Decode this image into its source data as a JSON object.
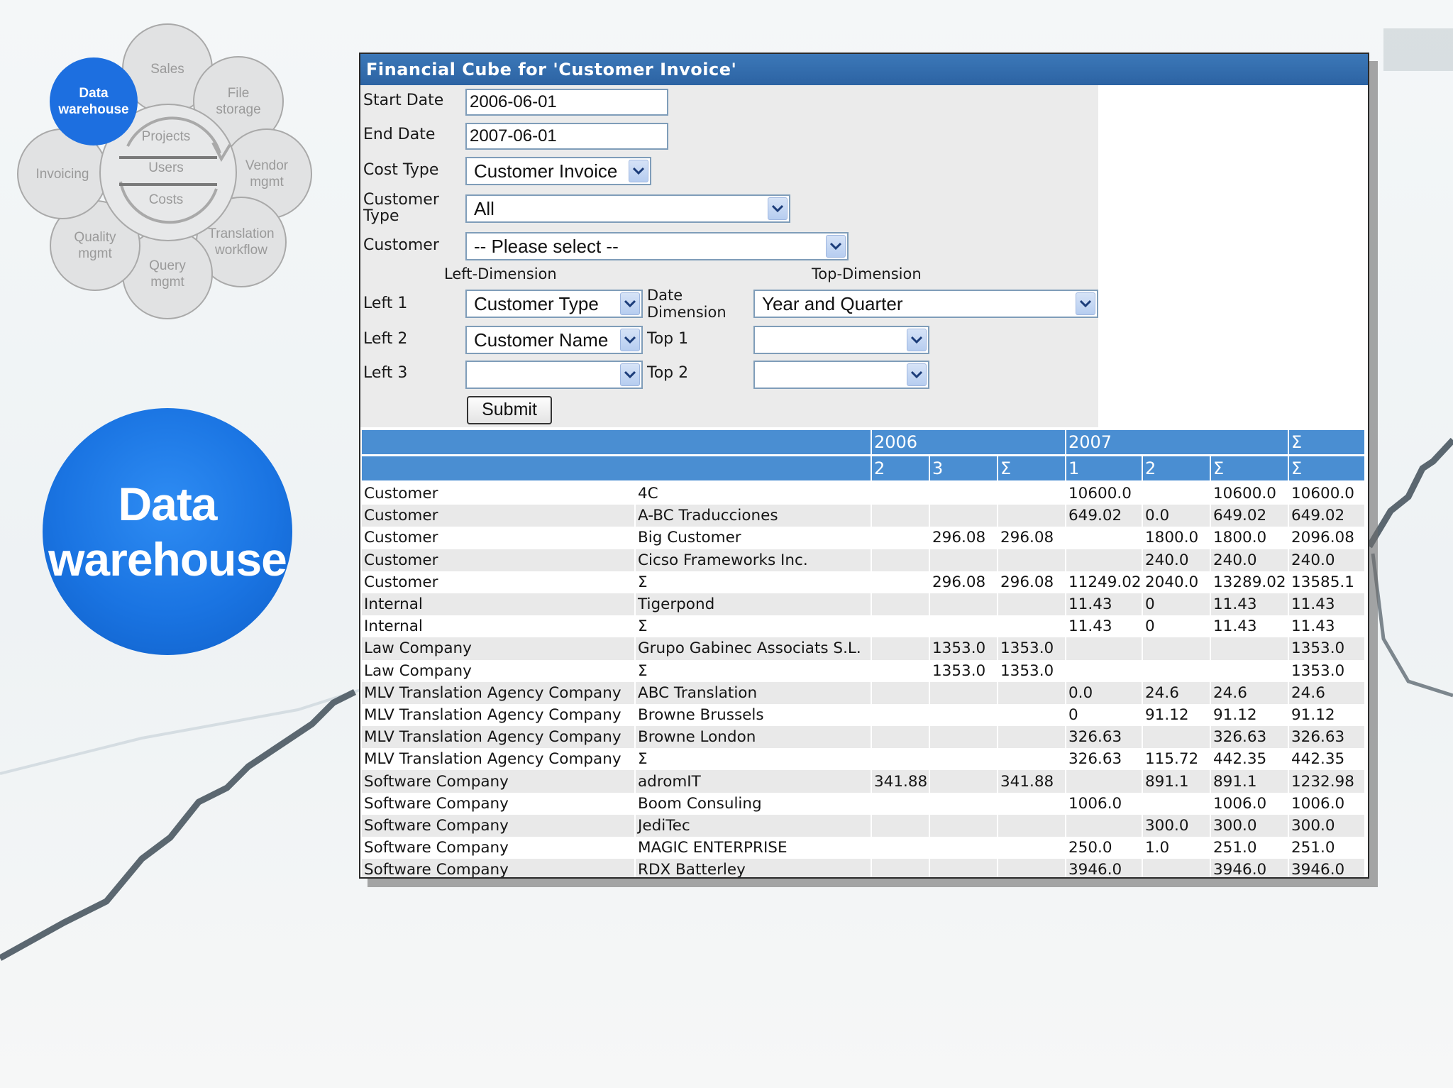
{
  "diagram": {
    "petals": [
      {
        "key": "data-warehouse",
        "label": "Data\nwarehouse",
        "active": true
      },
      {
        "key": "sales",
        "label": "Sales",
        "active": false
      },
      {
        "key": "file-storage",
        "label": "File\nstorage",
        "active": false
      },
      {
        "key": "vendor-mgmt",
        "label": "Vendor\nmgmt",
        "active": false
      },
      {
        "key": "translation-workflow",
        "label": "Translation\nworkflow",
        "active": false
      },
      {
        "key": "query-mgmt",
        "label": "Query\nmgmt",
        "active": false
      },
      {
        "key": "quality-mgmt",
        "label": "Quality\nmgmt",
        "active": false
      },
      {
        "key": "invoicing",
        "label": "Invoicing",
        "active": false
      }
    ],
    "hub": [
      "Projects",
      "Users",
      "Costs"
    ],
    "highlight_label": "Data warehouse"
  },
  "window": {
    "title": "Financial Cube for 'Customer Invoice'"
  },
  "form": {
    "start_date_label": "Start Date",
    "start_date_value": "2006-06-01",
    "end_date_label": "End Date",
    "end_date_value": "2007-06-01",
    "cost_type_label": "Cost Type",
    "cost_type_value": "Customer Invoice",
    "customer_type_label": "Customer Type",
    "customer_type_value": "All",
    "customer_label": "Customer",
    "customer_value": "-- Please select --",
    "left_dimension_header": "Left-Dimension",
    "top_dimension_header": "Top-Dimension",
    "left1_label": "Left 1",
    "left1_value": "Customer Type",
    "left2_label": "Left 2",
    "left2_value": "Customer Name",
    "left3_label": "Left 3",
    "left3_value": "",
    "date_dimension_label": "Date Dimension",
    "date_dimension_value": "Year and Quarter",
    "top1_label": "Top 1",
    "top1_value": "",
    "top2_label": "Top 2",
    "top2_value": "",
    "submit_label": "Submit"
  },
  "table": {
    "header_years": [
      "2006",
      "2007",
      "Σ"
    ],
    "header_quarters": [
      "2",
      "3",
      "Σ",
      "1",
      "2",
      "Σ",
      "Σ"
    ],
    "rows": [
      [
        "Customer",
        "4C",
        "",
        "",
        "",
        "10600.0",
        "",
        "10600.0",
        "10600.0"
      ],
      [
        "Customer",
        "A-BC Traducciones",
        "",
        "",
        "",
        "649.02",
        "0.0",
        "649.02",
        "649.02"
      ],
      [
        "Customer",
        "Big Customer",
        "",
        "296.08",
        "296.08",
        "",
        "1800.0",
        "1800.0",
        "2096.08"
      ],
      [
        "Customer",
        "Cicso Frameworks Inc.",
        "",
        "",
        "",
        "",
        "240.0",
        "240.0",
        "240.0"
      ],
      [
        "Customer",
        "Σ",
        "",
        "296.08",
        "296.08",
        "11249.02",
        "2040.0",
        "13289.02",
        "13585.1"
      ],
      [
        "Internal",
        "Tigerpond",
        "",
        "",
        "",
        "11.43",
        "0",
        "11.43",
        "11.43"
      ],
      [
        "Internal",
        "Σ",
        "",
        "",
        "",
        "11.43",
        "0",
        "11.43",
        "11.43"
      ],
      [
        "Law Company",
        "Grupo Gabinec Associats S.L.",
        "",
        "1353.0",
        "1353.0",
        "",
        "",
        "",
        "1353.0"
      ],
      [
        "Law Company",
        "Σ",
        "",
        "1353.0",
        "1353.0",
        "",
        "",
        "",
        "1353.0"
      ],
      [
        "MLV Translation Agency Company",
        "ABC Translation",
        "",
        "",
        "",
        "0.0",
        "24.6",
        "24.6",
        "24.6"
      ],
      [
        "MLV Translation Agency Company",
        "Browne Brussels",
        "",
        "",
        "",
        "0",
        "91.12",
        "91.12",
        "91.12"
      ],
      [
        "MLV Translation Agency Company",
        "Browne London",
        "",
        "",
        "",
        "326.63",
        "",
        "326.63",
        "326.63"
      ],
      [
        "MLV Translation Agency Company",
        "Σ",
        "",
        "",
        "",
        "326.63",
        "115.72",
        "442.35",
        "442.35"
      ],
      [
        "Software Company",
        "adromIT",
        "341.88",
        "",
        "341.88",
        "",
        "891.1",
        "891.1",
        "1232.98"
      ],
      [
        "Software Company",
        "Boom Consuling",
        "",
        "",
        "",
        "1006.0",
        "",
        "1006.0",
        "1006.0"
      ],
      [
        "Software Company",
        "JediTec",
        "",
        "",
        "",
        "",
        "300.0",
        "300.0",
        "300.0"
      ],
      [
        "Software Company",
        "MAGIC ENTERPRISE",
        "",
        "",
        "",
        "250.0",
        "1.0",
        "251.0",
        "251.0"
      ],
      [
        "Software Company",
        "RDX Batterley",
        "",
        "",
        "",
        "3946.0",
        "",
        "3946.0",
        "3946.0"
      ]
    ]
  },
  "colors": {
    "title_bar": "#2c63a3",
    "table_header": "#4a8ed2",
    "accent_blue": "#1a74e2"
  }
}
